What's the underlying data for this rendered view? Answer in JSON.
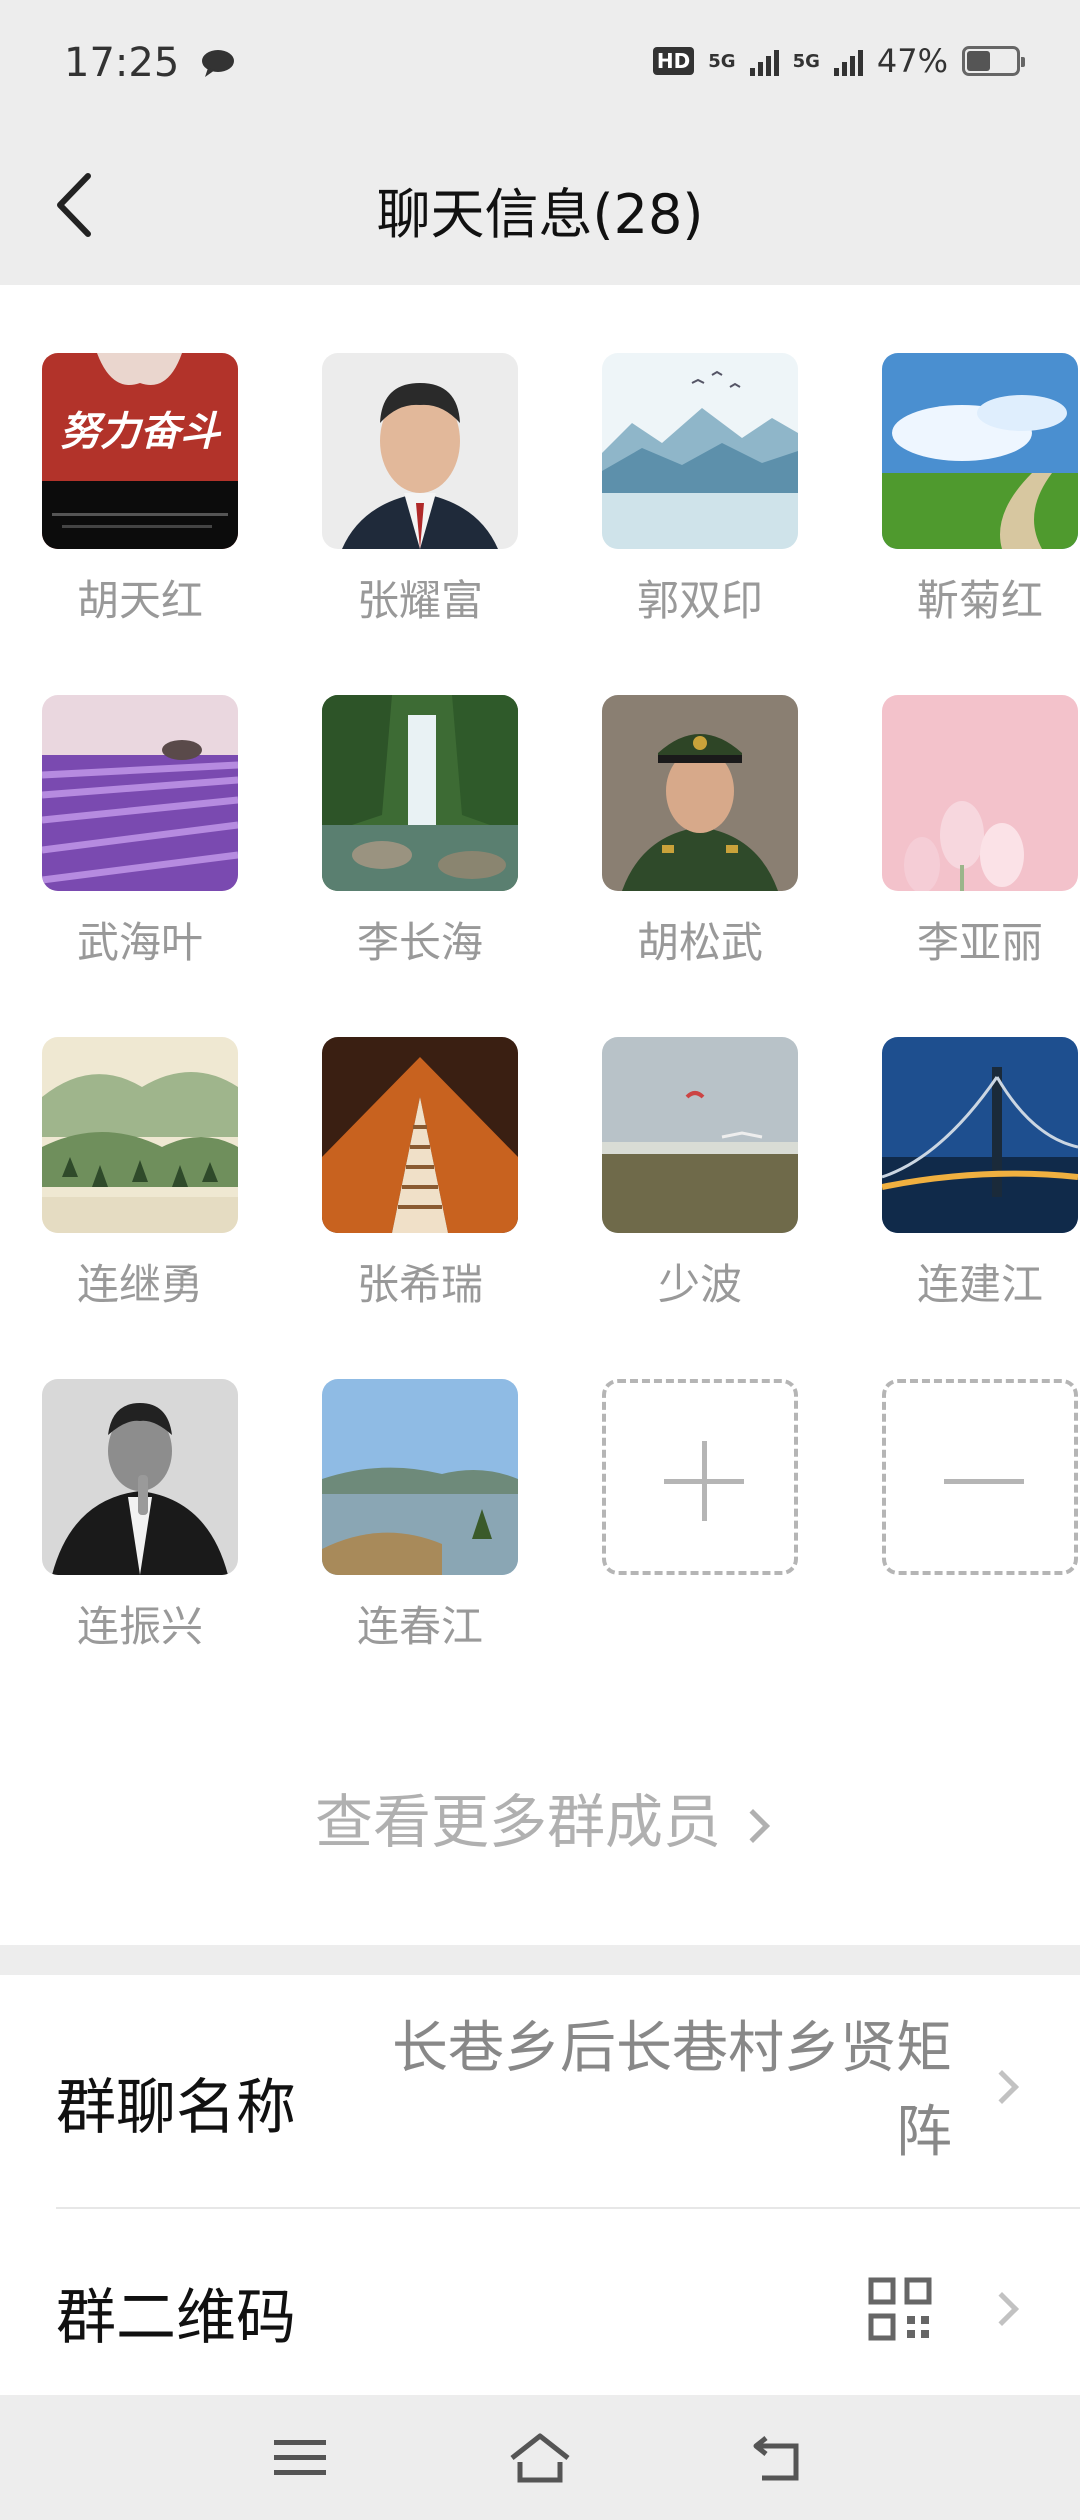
{
  "status": {
    "time": "17:25",
    "hd_label": "HD",
    "net1": "5G",
    "net2": "5G",
    "battery": "47%",
    "battery_level": 0.47
  },
  "header": {
    "title": "聊天信息(28)"
  },
  "members": [
    {
      "name": "胡天红",
      "avatar": "poster-avatar"
    },
    {
      "name": "张耀富",
      "avatar": "portrait-avatar"
    },
    {
      "name": "郭双印",
      "avatar": "mountain-lake-avatar"
    },
    {
      "name": "靳菊红",
      "avatar": "meadow-avatar"
    },
    {
      "name": "武海叶",
      "avatar": "lavender-avatar"
    },
    {
      "name": "李长海",
      "avatar": "waterfall-avatar"
    },
    {
      "name": "胡松武",
      "avatar": "soldier-avatar"
    },
    {
      "name": "李亚丽",
      "avatar": "tulip-avatar"
    },
    {
      "name": "连继勇",
      "avatar": "landscape-painting-avatar"
    },
    {
      "name": "张希瑞",
      "avatar": "escalator-avatar"
    },
    {
      "name": "少波",
      "avatar": "beach-avatar"
    },
    {
      "name": "连建江",
      "avatar": "bridge-avatar"
    },
    {
      "name": "连振兴",
      "avatar": "man-portrait-avatar"
    },
    {
      "name": "连春江",
      "avatar": "coast-avatar"
    }
  ],
  "poster_text": "努力奋斗",
  "more_members": "查看更多群成员",
  "settings": {
    "group_name_label": "群聊名称",
    "group_name_value": "长巷乡后长巷村乡贤矩阵",
    "qr_label": "群二维码"
  },
  "colors": {
    "background": "#ededed",
    "card": "#ffffff",
    "muted_text": "#999999"
  }
}
